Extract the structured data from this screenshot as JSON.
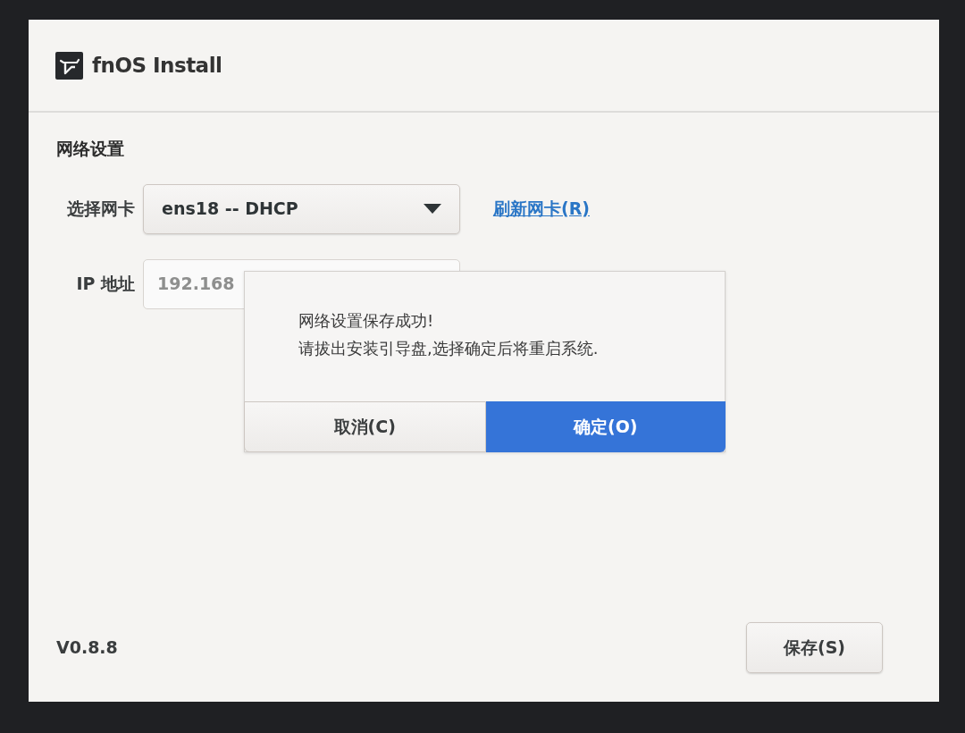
{
  "window": {
    "title": "fnOS Install"
  },
  "section": {
    "title": "网络设置"
  },
  "fields": [
    {
      "kind": "select",
      "label": "选择网卡",
      "value": "ens18 -- DHCP",
      "disabled": false
    },
    {
      "kind": "input",
      "label": "IP 地址",
      "value": "192.168",
      "disabled": true
    }
  ],
  "refresh_link": {
    "label": "刷新网卡(R)"
  },
  "footer": {
    "version": "V0.8.8",
    "save_button": "保存(S)"
  },
  "dialog": {
    "lines": [
      "网络设置保存成功!",
      "请拔出安装引导盘,选择确定后将重启系统."
    ],
    "buttons": [
      {
        "label": "取消(C)",
        "default": false
      },
      {
        "label": "确定(O)",
        "default": true
      }
    ]
  }
}
